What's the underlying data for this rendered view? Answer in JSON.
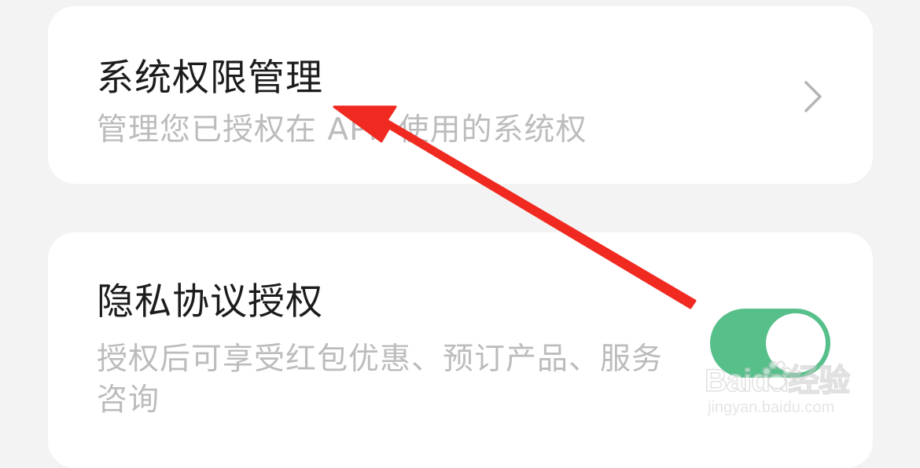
{
  "system_permissions": {
    "title": "系统权限管理",
    "description": "管理您已授权在 APP 使用的系统权"
  },
  "privacy_authorization": {
    "title": "隐私协议授权",
    "description": "授权后可享受红包优惠、预订产品、服务咨询",
    "enabled": true
  },
  "icons": {
    "chevron": "chevron-right-icon",
    "annotation": "red-arrow-annotation"
  },
  "colors": {
    "background": "#f3f3f3",
    "card": "#ffffff",
    "toggle_on": "#57c08a",
    "arrow": "#f02a21"
  },
  "watermark": {
    "brand": "Baidu经验",
    "url": "jingyan.baidu.com"
  }
}
